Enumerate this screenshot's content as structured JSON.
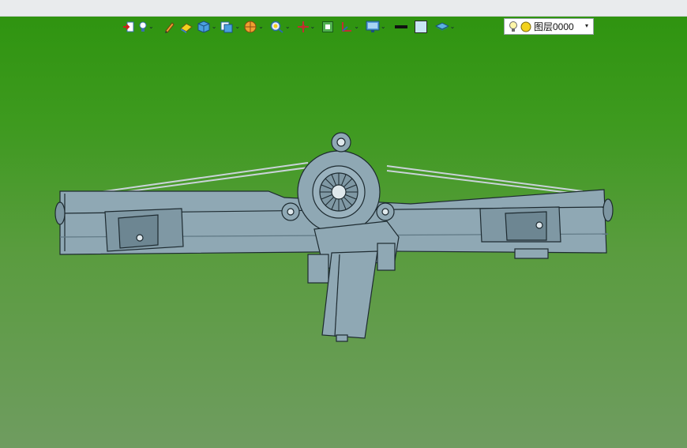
{
  "window": {
    "top_strip": ""
  },
  "toolbar": {
    "items": [
      {
        "icon": "exit-icon",
        "dropdown": false
      },
      {
        "icon": "light-bulb-icon",
        "dropdown": true
      },
      {
        "icon": "pencil-icon",
        "dropdown": false
      },
      {
        "icon": "eraser-icon",
        "dropdown": false
      },
      {
        "icon": "cube-icon",
        "dropdown": true
      },
      {
        "icon": "view-cube-icon",
        "dropdown": true
      },
      {
        "icon": "render-sphere-icon",
        "dropdown": true
      },
      {
        "icon": "zoom-icon",
        "dropdown": true
      },
      {
        "icon": "move-icon",
        "dropdown": true
      },
      {
        "icon": "frame-icon",
        "dropdown": false
      },
      {
        "icon": "ucs-icon",
        "dropdown": true
      },
      {
        "icon": "monitor-icon",
        "dropdown": true
      },
      {
        "icon": "line-color-icon",
        "dropdown": false
      },
      {
        "icon": "fill-color-icon",
        "dropdown": false
      },
      {
        "icon": "layers-icon",
        "dropdown": true
      }
    ],
    "dropdown_glyph": "⌄"
  },
  "layer": {
    "current": "图层0000",
    "arrow": "▾",
    "colors": {
      "bulb": "#fff6a8",
      "circle": "#f3d21c"
    }
  },
  "colors": {
    "background_top": "#2f9410",
    "background_bottom": "#6f9c60",
    "model_fill": "#8fa8b4",
    "model_stroke": "#1d2a30"
  }
}
